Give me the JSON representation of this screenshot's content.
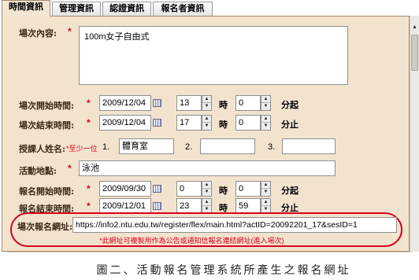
{
  "tabs": [
    {
      "label": "時間資訊"
    },
    {
      "label": "管理資訊"
    },
    {
      "label": "認證資訊"
    },
    {
      "label": "報名者資訊"
    }
  ],
  "form": {
    "content_label": "場次內容:",
    "content_value": "100m女子自由式",
    "start_label": "場次開始時間:",
    "start_date": "2009/12/04",
    "start_hour": "13",
    "start_minute": "0",
    "end_label": "場次結束時間:",
    "end_date": "2009/12/04",
    "end_hour": "17",
    "end_minute": "0",
    "hour_unit": "時",
    "minute_start_unit": "分起",
    "minute_end_unit": "分止",
    "instructor_label": "授課人姓名:",
    "instructor_hint": "*至少一位",
    "instructor_num1": "1.",
    "instructor_num2": "2.",
    "instructor_num3": "3.",
    "instructor_1": "體育室",
    "instructor_2": "",
    "instructor_3": "",
    "location_label": "活動地點:",
    "location_value": "泳池",
    "reg_start_label": "報名開始時間:",
    "reg_start_date": "2009/09/30",
    "reg_start_hour": "0",
    "reg_start_minute": "0",
    "reg_end_label": "報名結束時間:",
    "reg_end_date": "2009/12/01",
    "reg_end_hour": "23",
    "reg_end_minute": "59",
    "url_label": "場次報名網址:",
    "url_value": "https://info2.ntu.edu.tw/register/flex/main.html?actID=20092201_17&sesID=1",
    "url_hint": "*此網址可複製用作為公告或通知信報名連結網址(進入場次)",
    "required_mark": "*"
  },
  "caption": "圖二、活動報名管理系統所產生之報名網址",
  "colors": {
    "panel": "#f2e3cf",
    "required": "#e0001a",
    "highlight": "#d8001c"
  }
}
